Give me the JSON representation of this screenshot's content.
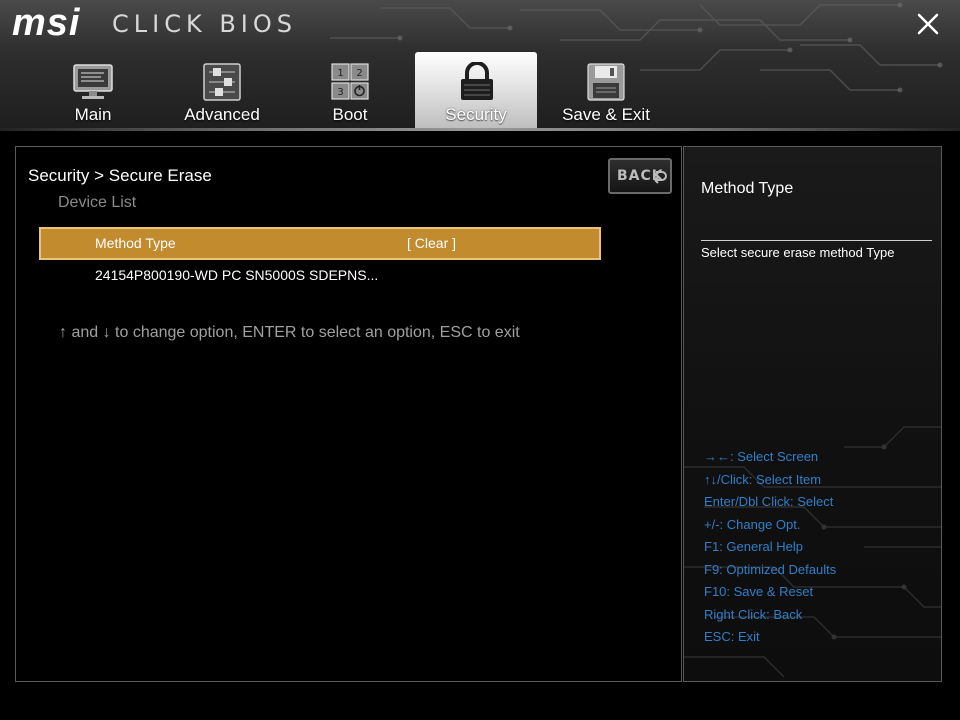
{
  "header": {
    "logo": "msi",
    "product": "CLICK BIOS",
    "close_icon": "close-x-icon"
  },
  "tabs": [
    {
      "label": "Main",
      "icon": "monitor-icon",
      "active": false
    },
    {
      "label": "Advanced",
      "icon": "sliders-icon",
      "active": false
    },
    {
      "label": "Boot",
      "icon": "boot-order-icon",
      "active": false
    },
    {
      "label": "Security",
      "icon": "padlock-icon",
      "active": true
    },
    {
      "label": "Save & Exit",
      "icon": "floppy-disk-icon",
      "active": false
    }
  ],
  "main": {
    "breadcrumb": "Security > Secure Erase",
    "section_label": "Device List",
    "back_label": "BACK",
    "back_icon": "return-arrow-icon",
    "rows": [
      {
        "label": "Method Type",
        "value": "[ Clear ]",
        "selected": true
      },
      {
        "label": "24154P800190-WD PC SN5000S SDEPNS...",
        "value": "",
        "selected": false
      }
    ],
    "hint": "↑ and ↓ to change option, ENTER to select an option, ESC to exit"
  },
  "help": {
    "title": "Method Type",
    "description": "Select secure erase method Type",
    "keys": [
      "→←: Select Screen",
      "↑↓/Click: Select Item",
      "Enter/Dbl Click: Select",
      "+/-: Change Opt.",
      "F1: General Help",
      "F9: Optimized Defaults",
      "F10: Save & Reset",
      "Right Click: Back",
      "ESC: Exit"
    ]
  },
  "colors": {
    "selection_fill": "#c28b2e",
    "selection_border": "#e7c47a",
    "key_help_text": "#2f7fc9",
    "dim_text": "#8a8a8a"
  }
}
